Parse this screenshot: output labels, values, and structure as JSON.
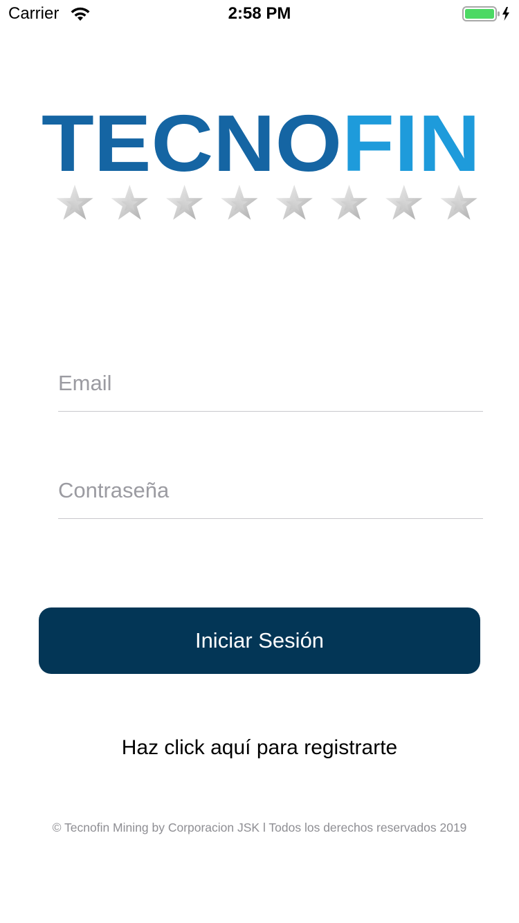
{
  "status_bar": {
    "carrier": "Carrier",
    "time": "2:58 PM",
    "wifi_icon": "wifi-icon",
    "battery_icon": "battery-charging-icon",
    "battery_color": "#4cd964"
  },
  "logo": {
    "text_part1": "TECNO",
    "text_part2": "FIN",
    "color_part1": "#1565a3",
    "color_part2": "#1e9bdb",
    "stars_count": 8
  },
  "form": {
    "email_placeholder": "Email",
    "email_value": "",
    "password_placeholder": "Contraseña",
    "password_value": ""
  },
  "login_button": {
    "label": "Iniciar Sesión",
    "color": "#033656"
  },
  "register_link": {
    "label": "Haz click aquí para registrarte"
  },
  "footer": {
    "text": "© Tecnofin Mining by Corporacion JSK l Todos los derechos reservados 2019"
  }
}
